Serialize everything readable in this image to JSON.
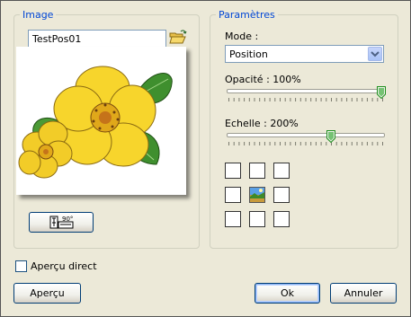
{
  "image_group": {
    "legend": "Image",
    "filename": "TestPos01",
    "open_icon": "folder-open-icon",
    "rotate_icon": "rotate-90-icon",
    "rotate_icon_text": "90°"
  },
  "params_group": {
    "legend": "Paramètres",
    "mode_label": "Mode :",
    "mode_value": "Position",
    "opacity_label": "Opacité : 100%",
    "opacity_value": 100,
    "scale_label": "Echelle : 200%",
    "scale_value": 200,
    "position_grid": {
      "rows": 3,
      "cols": 3,
      "selected": "center",
      "cells": [
        "top-left",
        "top-center",
        "top-right",
        "middle-left",
        "center",
        "middle-right",
        "bottom-left",
        "bottom-center",
        "bottom-right"
      ]
    }
  },
  "live_preview": {
    "label": "Aperçu direct",
    "checked": false
  },
  "buttons": {
    "preview": "Aperçu",
    "ok": "Ok",
    "cancel": "Annuler"
  },
  "colors": {
    "background": "#ece9d8",
    "group_title": "#0046d5",
    "flower_yellow": "#f7d52c",
    "leaf_green": "#3f8f2e"
  }
}
